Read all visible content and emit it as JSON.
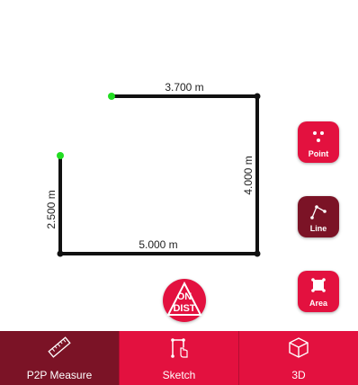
{
  "sketch": {
    "segments": [
      {
        "label": "3.700 m"
      },
      {
        "label": "4.000 m"
      },
      {
        "label": "5.000 m"
      },
      {
        "label": "2.500 m"
      }
    ]
  },
  "tools": {
    "point": {
      "label": "Point",
      "icon": "three-dots-icon"
    },
    "line": {
      "label": "Line",
      "icon": "line-nodes-icon"
    },
    "area": {
      "label": "Area",
      "icon": "area-square-icon"
    }
  },
  "ondist": {
    "top": "ON",
    "bottom": "DIST"
  },
  "tabs": [
    {
      "label": "P2P Measure",
      "icon": "ruler-icon"
    },
    {
      "label": "Sketch",
      "icon": "sketch-hand-icon"
    },
    {
      "label": "3D",
      "icon": "cube-icon"
    }
  ],
  "colors": {
    "accent": "#e3113f",
    "active": "#7b1326",
    "start_point": "#22dd22"
  }
}
